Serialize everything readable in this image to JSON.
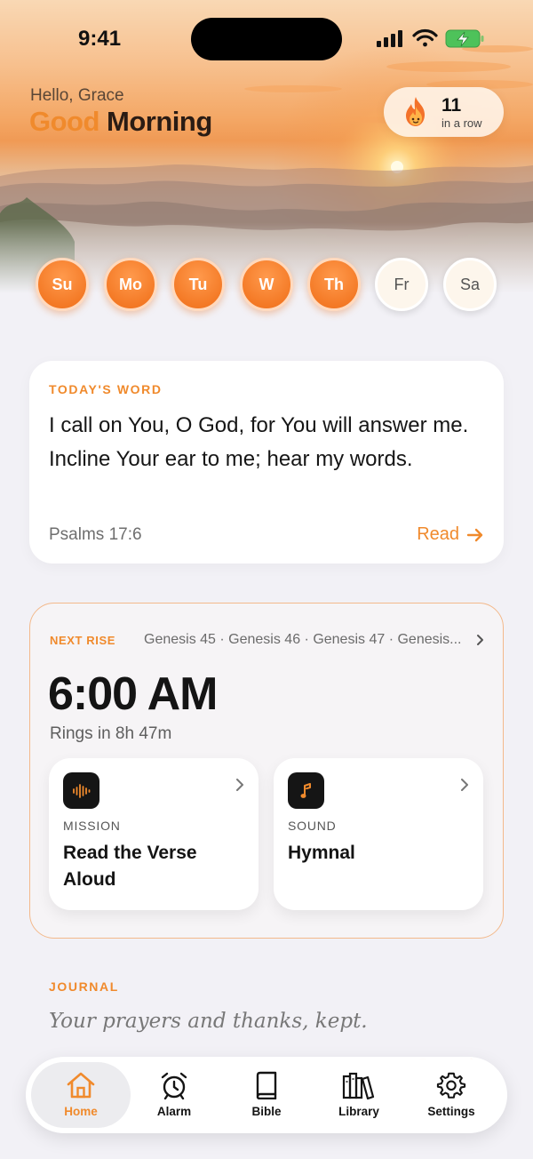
{
  "status": {
    "time": "9:41"
  },
  "greeting": {
    "hello": "Hello, Grace",
    "good": "Good",
    "morning": "Morning"
  },
  "streak": {
    "count": "11",
    "label": "in a row",
    "icon": "flame-icon"
  },
  "days": [
    {
      "label": "Su",
      "done": true
    },
    {
      "label": "Mo",
      "done": true
    },
    {
      "label": "Tu",
      "done": true
    },
    {
      "label": "W",
      "done": true
    },
    {
      "label": "Th",
      "done": true
    },
    {
      "label": "Fr",
      "done": false
    },
    {
      "label": "Sa",
      "done": false
    }
  ],
  "word": {
    "eyebrow": "TODAY'S WORD",
    "verse": "I call on You, O God, for You will answer me. Incline Your ear to me; hear my words.",
    "reference": "Psalms 17:6",
    "read_label": "Read"
  },
  "rise": {
    "eyebrow": "NEXT RISE",
    "plan": "Genesis 45 · Genesis 46 · Genesis 47 · Genesis...",
    "time": "6:00 AM",
    "rings": "Rings in 8h 47m",
    "mission": {
      "label": "MISSION",
      "value": "Read the Verse Aloud",
      "icon": "waveform-icon"
    },
    "sound": {
      "label": "SOUND",
      "value": "Hymnal",
      "icon": "music-note-icon"
    }
  },
  "journal": {
    "eyebrow": "JOURNAL",
    "placeholder": "Your prayers and thanks, kept."
  },
  "tabs": [
    {
      "label": "Home",
      "icon": "home-icon",
      "active": true
    },
    {
      "label": "Alarm",
      "icon": "alarm-clock-icon",
      "active": false
    },
    {
      "label": "Bible",
      "icon": "book-icon",
      "active": false
    },
    {
      "label": "Library",
      "icon": "library-icon",
      "active": false
    },
    {
      "label": "Settings",
      "icon": "gear-icon",
      "active": false
    }
  ],
  "colors": {
    "accent": "#f08a2c",
    "background": "#f2f1f6",
    "dark": "#141414"
  }
}
